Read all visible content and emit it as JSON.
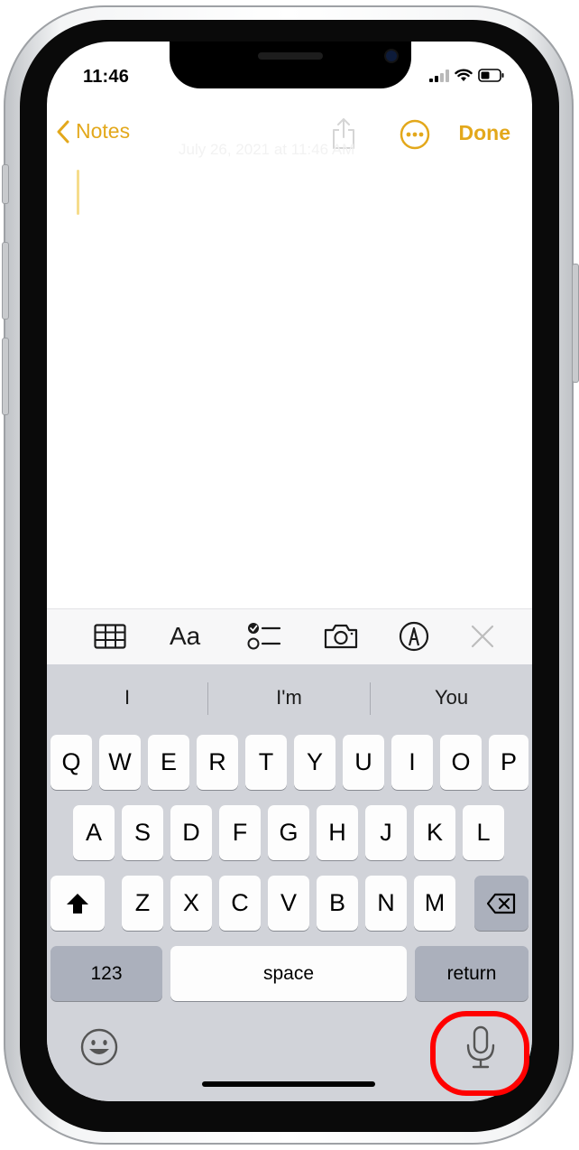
{
  "status_bar": {
    "time": "11:46"
  },
  "nav": {
    "back_label": "Notes",
    "done_label": "Done"
  },
  "note": {
    "timestamp": "July 26, 2021 at 11:46 AM"
  },
  "toolbar": {
    "format_label": "Aa"
  },
  "predictions": [
    "I",
    "I'm",
    "You"
  ],
  "keyboard": {
    "row1": [
      "Q",
      "W",
      "E",
      "R",
      "T",
      "Y",
      "U",
      "I",
      "O",
      "P"
    ],
    "row2": [
      "A",
      "S",
      "D",
      "F",
      "G",
      "H",
      "J",
      "K",
      "L"
    ],
    "row3": [
      "Z",
      "X",
      "C",
      "V",
      "B",
      "N",
      "M"
    ],
    "numbers_label": "123",
    "space_label": "space",
    "return_label": "return"
  },
  "colors": {
    "accent": "#e3a81b",
    "highlight": "#ff0000",
    "keyboard_bg": "#d1d3d9"
  },
  "icons": [
    "back-chevron-icon",
    "share-icon",
    "more-icon",
    "table-icon",
    "checklist-icon",
    "camera-icon",
    "markup-icon",
    "close-icon",
    "shift-icon",
    "delete-icon",
    "emoji-icon",
    "microphone-icon"
  ]
}
